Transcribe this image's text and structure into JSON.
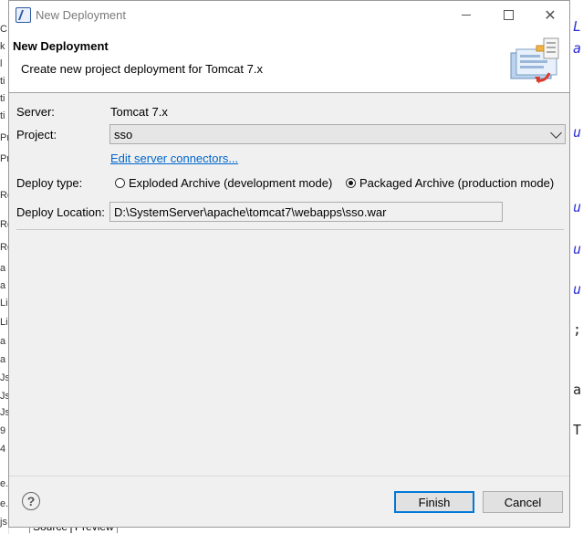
{
  "window": {
    "title": "New Deployment",
    "min_label": "—",
    "max_label": "□",
    "close_label": "✕"
  },
  "header": {
    "title": "New Deployment",
    "description": "Create new project deployment for Tomcat  7.x"
  },
  "form": {
    "server_label": "Server:",
    "server_value": "Tomcat  7.x",
    "project_label": "Project:",
    "project_value": "sso",
    "connectors_link": "Edit server connectors...",
    "deploy_type_label": "Deploy type:",
    "exploded_label": "Exploded Archive (development mode)",
    "packaged_label": "Packaged Archive (production mode)",
    "selected_deploy_type": "packaged",
    "deploy_location_label": "Deploy Location:",
    "deploy_location_value": "D:\\SystemServer\\apache\\tomcat7\\webapps\\sso.war"
  },
  "footer": {
    "help_label": "?",
    "finish_label": "Finish",
    "cancel_label": "Cancel"
  },
  "background": {
    "left_chars": [
      "C",
      "k",
      "l",
      "ti",
      "ti",
      "ti",
      "Pr",
      "Pr",
      "Ro",
      "Ro",
      "Ro",
      "a",
      "a",
      "Li",
      "Li",
      "a",
      "a",
      "Js",
      "Js",
      "Js",
      "9",
      "4",
      "",
      "e.j",
      "e.j",
      "js"
    ],
    "right_chars": [
      "L",
      "a",
      "u",
      "u",
      "u",
      "u",
      ";",
      "a",
      "T"
    ],
    "bottom_tabs": [
      "Source",
      "Preview"
    ]
  }
}
